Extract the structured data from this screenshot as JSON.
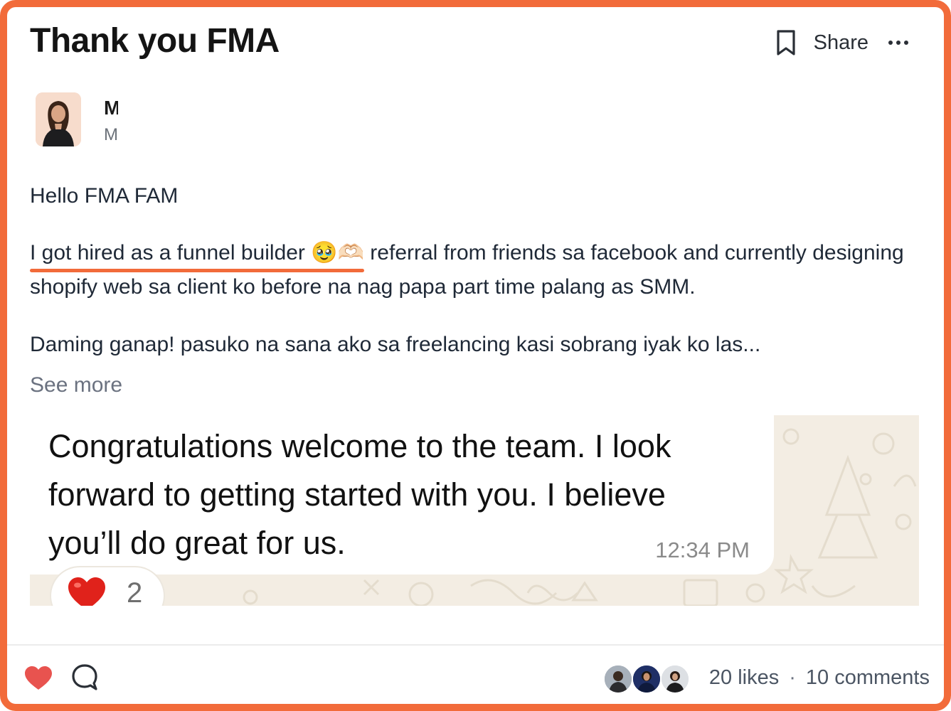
{
  "post": {
    "title": "Thank you FMA",
    "share_label": "Share"
  },
  "author": {
    "name": "M",
    "meta": "M"
  },
  "content": {
    "greeting": "Hello FMA FAM",
    "para1_highlight": "I got hired as a funnel builder 🥹🫶🏻",
    "para1_rest": " referral from friends sa facebook and currently designing shopify web sa client ko before na nag papa part time palang as SMM.",
    "para2": "Daming ganap! pasuko na sana ako sa freelancing kasi sobrang iyak ko las...",
    "see_more": "See more"
  },
  "chat": {
    "message": "Congratulations welcome to the team. I look forward to getting started with you. I believe you’ll do great for us.",
    "time": "12:34 PM",
    "reaction_count": "2"
  },
  "footer": {
    "likes": "20 likes",
    "separator": "·",
    "comments": "10 comments"
  },
  "colors": {
    "accent": "#f26b3a",
    "like_heart": "#e8534f",
    "chat_background": "#f3ede3"
  },
  "icons": [
    "bookmark-icon",
    "more-dots-icon",
    "heart-icon",
    "comment-icon",
    "heart-reaction-icon"
  ]
}
